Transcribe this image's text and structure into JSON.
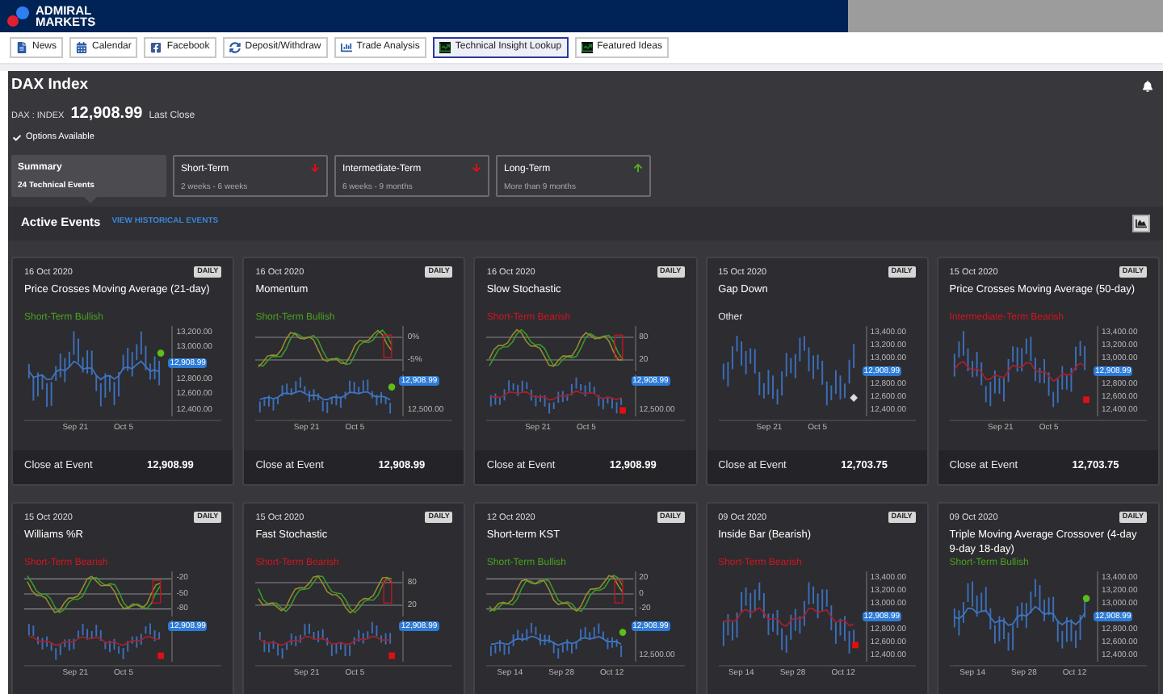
{
  "brand": {
    "lines": [
      "ADMIRAL",
      "MARKETS"
    ]
  },
  "toolbar": [
    {
      "label": "News",
      "selected": false
    },
    {
      "label": "Calendar",
      "selected": false
    },
    {
      "label": "Facebook",
      "selected": false
    },
    {
      "label": "Deposit/Withdraw",
      "selected": false
    },
    {
      "label": "Trade Analysis",
      "selected": false
    },
    {
      "label": "Technical Insight Lookup",
      "selected": true
    },
    {
      "label": "Featured Ideas",
      "selected": false
    }
  ],
  "instrument": {
    "title": "DAX Index",
    "symbol": "DAX : INDEX",
    "price": "12,908.99",
    "price_note": "Last Close",
    "options": "Options Available"
  },
  "periods": [
    {
      "title": "Summary",
      "subtitle": "24 Technical Events",
      "selected": true,
      "arrow_up": false,
      "arrow_down": false
    },
    {
      "title": "Short-Term",
      "subtitle": "2 weeks - 6 weeks",
      "selected": false,
      "arrow_up": false,
      "arrow_down": true
    },
    {
      "title": "Intermediate-Term",
      "subtitle": "6 weeks - 9 months",
      "selected": false,
      "arrow_up": false,
      "arrow_down": true
    },
    {
      "title": "Long-Term",
      "subtitle": "More than 9 months",
      "selected": false,
      "arrow_up": true,
      "arrow_down": false
    }
  ],
  "events_bar": {
    "title": "Active Events",
    "link": "VIEW HISTORICAL EVENTS"
  },
  "events": [
    {
      "date": "16 Oct 2020",
      "badge": "DAILY",
      "title": "Price Crosses Moving Average (21-day)",
      "signal": "Short-Term Bullish",
      "bullish": true,
      "bearish": false,
      "kind": "price",
      "y_axis": [
        {
          "text": "13,200.00",
          "kind": "tick"
        },
        {
          "text": "13,000.00",
          "kind": "tick"
        },
        {
          "text": "12,908.99",
          "kind": "price_tag"
        },
        {
          "text": "12,800.00",
          "kind": "tick"
        },
        {
          "text": "12,600.00",
          "kind": "tick"
        },
        {
          "text": "12,400.00",
          "kind": "tick"
        }
      ],
      "x_labels": [
        "Sep 21",
        "Oct 5"
      ],
      "close_label": "Close at Event",
      "close": "12,908.99"
    },
    {
      "date": "16 Oct 2020",
      "badge": "DAILY",
      "title": "Momentum",
      "signal": "Short-Term Bullish",
      "bullish": true,
      "bearish": false,
      "kind": "indicator",
      "indicator_axis": [
        "0%",
        "-5%"
      ],
      "y_axis": [
        {
          "text": "12,908.99",
          "kind": "price_tag"
        },
        {
          "text": "12,500.00",
          "kind": "tick"
        }
      ],
      "x_labels": [
        "Sep 21",
        "Oct 5"
      ],
      "close_label": "Close at Event",
      "close": "12,908.99"
    },
    {
      "date": "16 Oct 2020",
      "badge": "DAILY",
      "title": "Slow Stochastic",
      "signal": "Short-Term Bearish",
      "bullish": false,
      "bearish": true,
      "kind": "indicator",
      "indicator_axis": [
        "80",
        "20"
      ],
      "y_axis": [
        {
          "text": "12,908.99",
          "kind": "price_tag"
        },
        {
          "text": "12,500.00",
          "kind": "tick"
        }
      ],
      "x_labels": [
        "Sep 21",
        "Oct 5"
      ],
      "close_label": "Close at Event",
      "close": "12,908.99"
    },
    {
      "date": "15 Oct 2020",
      "badge": "DAILY",
      "title": "Gap Down",
      "signal": "Other",
      "bullish": false,
      "bearish": false,
      "kind": "price",
      "y_axis": [
        {
          "text": "13,400.00",
          "kind": "tick"
        },
        {
          "text": "13,200.00",
          "kind": "tick"
        },
        {
          "text": "13,000.00",
          "kind": "tick"
        },
        {
          "text": "12,908.99",
          "kind": "price_tag"
        },
        {
          "text": "12,800.00",
          "kind": "tick"
        },
        {
          "text": "12,600.00",
          "kind": "tick"
        },
        {
          "text": "12,400.00",
          "kind": "tick"
        }
      ],
      "x_labels": [
        "Sep 21",
        "Oct 5"
      ],
      "close_label": "Close at Event",
      "close": "12,703.75"
    },
    {
      "date": "15 Oct 2020",
      "badge": "DAILY",
      "title": "Price Crosses Moving Average (50-day)",
      "signal": "Intermediate-Term Bearish",
      "bullish": false,
      "bearish": true,
      "kind": "price",
      "y_axis": [
        {
          "text": "13,400.00",
          "kind": "tick"
        },
        {
          "text": "13,200.00",
          "kind": "tick"
        },
        {
          "text": "13,000.00",
          "kind": "tick"
        },
        {
          "text": "12,908.99",
          "kind": "price_tag"
        },
        {
          "text": "12,800.00",
          "kind": "tick"
        },
        {
          "text": "12,600.00",
          "kind": "tick"
        },
        {
          "text": "12,400.00",
          "kind": "tick"
        }
      ],
      "x_labels": [
        "Sep 21",
        "Oct 5"
      ],
      "close_label": "Close at Event",
      "close": "12,703.75"
    },
    {
      "date": "15 Oct 2020",
      "badge": "DAILY",
      "title": "Williams %R",
      "signal": "Short-Term Bearish",
      "bullish": false,
      "bearish": true,
      "kind": "indicator",
      "indicator_axis": [
        "-20",
        "-50",
        "-80"
      ],
      "y_axis": [
        {
          "text": "12,908.99",
          "kind": "price_tag"
        }
      ],
      "x_labels": [
        "Sep 21",
        "Oct 5"
      ]
    },
    {
      "date": "15 Oct 2020",
      "badge": "DAILY",
      "title": "Fast Stochastic",
      "signal": "Short-Term Bearish",
      "bullish": false,
      "bearish": true,
      "kind": "indicator",
      "indicator_axis": [
        "80",
        "20"
      ],
      "y_axis": [
        {
          "text": "12,908.99",
          "kind": "price_tag"
        }
      ],
      "x_labels": [
        "Sep 21",
        "Oct 5"
      ]
    },
    {
      "date": "12 Oct 2020",
      "badge": "DAILY",
      "title": "Short-term KST",
      "signal": "Short-Term Bullish",
      "bullish": true,
      "bearish": false,
      "kind": "indicator",
      "indicator_axis": [
        "20",
        "0",
        "-20"
      ],
      "y_axis": [
        {
          "text": "12,908.99",
          "kind": "price_tag"
        },
        {
          "text": "12,500.00",
          "kind": "tick"
        }
      ],
      "x_labels": [
        "Sep 14",
        "Sep 28",
        "Oct 12"
      ]
    },
    {
      "date": "09 Oct 2020",
      "badge": "DAILY",
      "title": "Inside Bar (Bearish)",
      "signal": "Short-Term Bearish",
      "bullish": false,
      "bearish": true,
      "kind": "price",
      "y_axis": [
        {
          "text": "13,400.00",
          "kind": "tick"
        },
        {
          "text": "13,200.00",
          "kind": "tick"
        },
        {
          "text": "13,000.00",
          "kind": "tick"
        },
        {
          "text": "12,908.99",
          "kind": "price_tag"
        },
        {
          "text": "12,800.00",
          "kind": "tick"
        },
        {
          "text": "12,600.00",
          "kind": "tick"
        },
        {
          "text": "12,400.00",
          "kind": "tick"
        }
      ],
      "x_labels": [
        "Sep 14",
        "Sep 28",
        "Oct 12"
      ]
    },
    {
      "date": "09 Oct 2020",
      "badge": "DAILY",
      "title": "Triple Moving Average Crossover (4-day 9-day 18-day)",
      "signal": "Short-Term Bullish",
      "bullish": true,
      "bearish": false,
      "kind": "price",
      "y_axis": [
        {
          "text": "13,400.00",
          "kind": "tick"
        },
        {
          "text": "13,200.00",
          "kind": "tick"
        },
        {
          "text": "13,000.00",
          "kind": "tick"
        },
        {
          "text": "12,908.99",
          "kind": "price_tag"
        },
        {
          "text": "12,800.00",
          "kind": "tick"
        },
        {
          "text": "12,600.00",
          "kind": "tick"
        },
        {
          "text": "12,400.00",
          "kind": "tick"
        }
      ],
      "x_labels": [
        "Sep 14",
        "Sep 28",
        "Oct 12"
      ]
    }
  ]
}
